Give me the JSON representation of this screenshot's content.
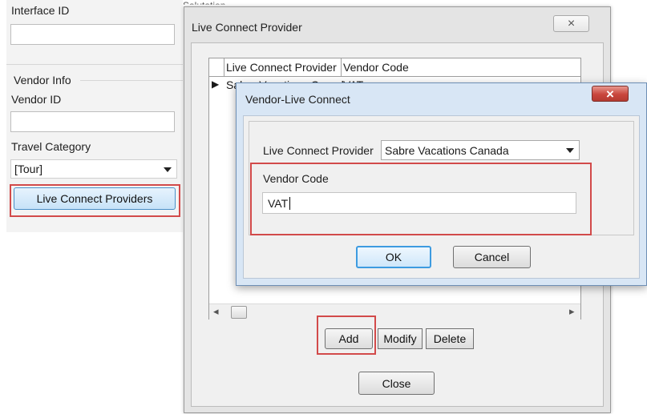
{
  "left_panel": {
    "interface_id_label": "Interface ID",
    "interface_id_value": "",
    "vendor_info_group": "Vendor Info",
    "vendor_id_label": "Vendor ID",
    "vendor_id_value": "",
    "travel_category_label": "Travel Category",
    "travel_category_value": "[Tour]",
    "live_connect_providers_button": "Live Connect Providers",
    "background_label_partial": "Salutation"
  },
  "live_connect_window": {
    "title": "Live Connect Provider",
    "close_glyph": "×",
    "grid": {
      "columns": [
        "Live Connect Provider",
        "Vendor Code"
      ],
      "row_marker": "▶",
      "rows": [
        [
          "Sabre Vacations Canada",
          "VAT"
        ]
      ]
    },
    "add_label": "Add",
    "modify_label": "Modify",
    "delete_label": "Delete",
    "close_label": "Close",
    "scroll_left": "◂",
    "scroll_right": "▸"
  },
  "vendor_dialog": {
    "title": "Vendor-Live Connect",
    "close_glyph": "×",
    "provider_label": "Live Connect Provider",
    "provider_value": "Sabre Vacations Canada",
    "vendor_code_label": "Vendor Code",
    "vendor_code_value": "VAT",
    "ok_label": "OK",
    "cancel_label": "Cancel"
  },
  "colors": {
    "highlight_red": "#d24a4a",
    "primary_button_blue": "#3d9be0",
    "close_button_red": "#c9463d"
  }
}
